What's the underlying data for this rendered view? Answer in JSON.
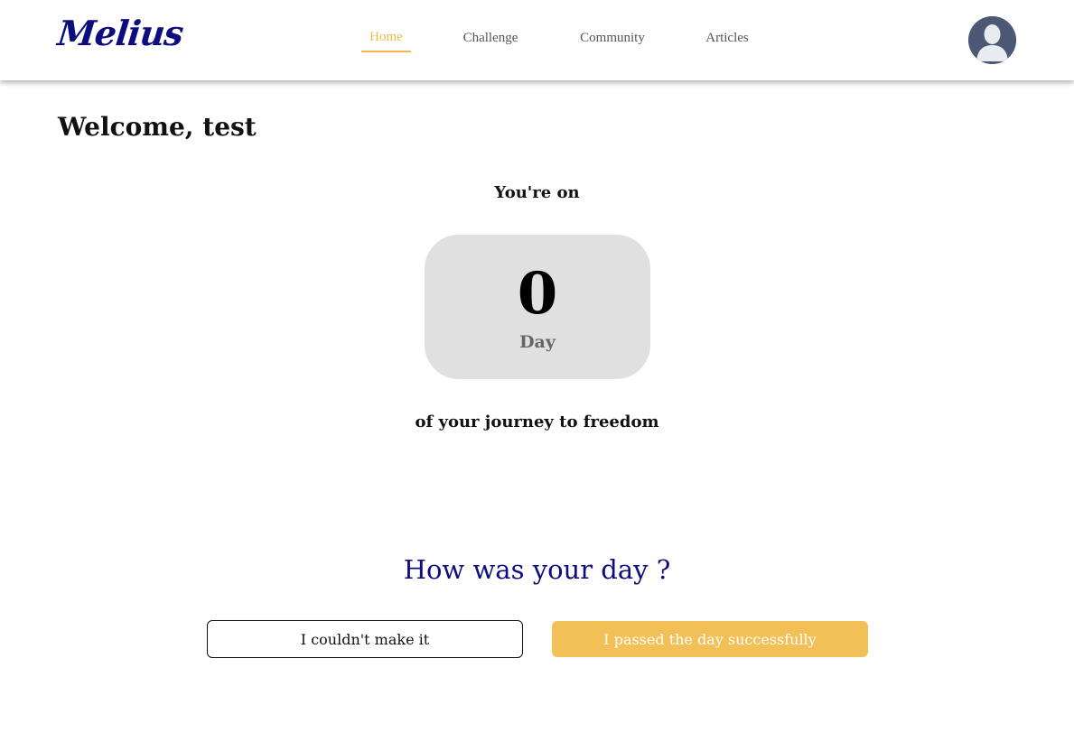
{
  "header": {
    "logo": "Melius",
    "nav": [
      {
        "label": "Home",
        "active": true
      },
      {
        "label": "Challenge",
        "active": false
      },
      {
        "label": "Community",
        "active": false
      },
      {
        "label": "Articles",
        "active": false
      }
    ],
    "avatar_icon": "user-silhouette-icon"
  },
  "main": {
    "welcome": "Welcome, test",
    "streak_prefix": "You're on",
    "streak_count": "0",
    "streak_unit": "Day",
    "streak_suffix": "of your journey to freedom",
    "question": "How was your day ?",
    "fail_button": "I couldn't make it",
    "pass_button": "I passed the day successfully"
  },
  "colors": {
    "brand_navy": "#0d0d80",
    "accent_yellow": "#f2b84b",
    "button_yellow": "#f2c057",
    "counter_bg": "#e0e0e0",
    "avatar_bg": "#4d5876"
  }
}
